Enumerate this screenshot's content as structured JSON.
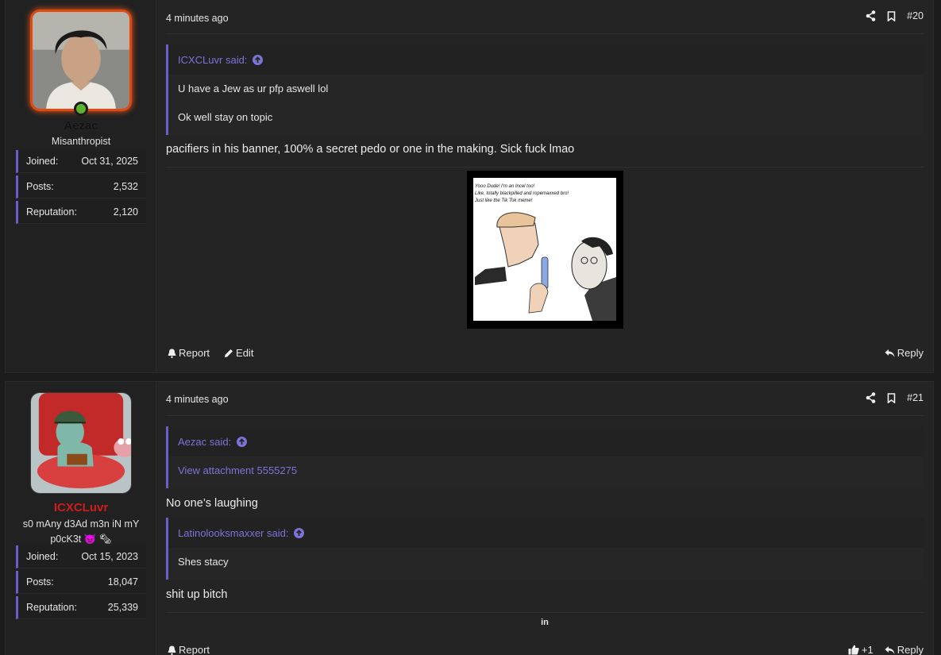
{
  "posts": [
    {
      "user": {
        "name": "Aezac",
        "title": "Misanthropist",
        "stats": [
          {
            "label": "Joined:",
            "value": "Oct 31, 2025"
          },
          {
            "label": "Posts:",
            "value": "2,532"
          },
          {
            "label": "Reputation:",
            "value": "2,120"
          }
        ]
      },
      "time": "4 minutes ago",
      "number": "#20",
      "quote": {
        "author": "ICXCLuvr said:",
        "lines": [
          "U have a Jew as ur pfp aswell lol",
          "Ok well stay on topic"
        ]
      },
      "body": "pacifiers in his banner, 100% a secret pedo or one in the making. Sick fuck lmao",
      "image_caption": [
        "Yooo Dude! I'm an Incel too!",
        "Like, totally blackpilled and ropemaxxed bro!",
        "Just like the Tik Tok meme!"
      ],
      "actions": {
        "report": "Report",
        "edit": "Edit",
        "reply": "Reply"
      }
    },
    {
      "user": {
        "name": "ICXCLuvr",
        "title": "s0 mAny d3Ad m3n iN mY p0cK3t 👿 🗞",
        "stats": [
          {
            "label": "Joined:",
            "value": "Oct 15, 2023"
          },
          {
            "label": "Posts:",
            "value": "18,047"
          },
          {
            "label": "Reputation:",
            "value": "25,339"
          }
        ]
      },
      "time": "4 minutes ago",
      "number": "#21",
      "quote1": {
        "author": "Aezac said:",
        "link": "View attachment 5555275"
      },
      "text1": "No one’s laughing",
      "quote2": {
        "author": "Latinolooksmaxxer said:",
        "lines": [
          "Shes stacy"
        ]
      },
      "text2": "shit up bitch",
      "small": "in",
      "actions": {
        "report": "Report",
        "likes": "+1",
        "reply": "Reply"
      }
    }
  ],
  "colors": {
    "accent": "#6a5fc8",
    "link": "#7a74d8",
    "username_red": "#d01c1c",
    "online": "#5bb52c",
    "avatar_glow": "#e2480f"
  }
}
